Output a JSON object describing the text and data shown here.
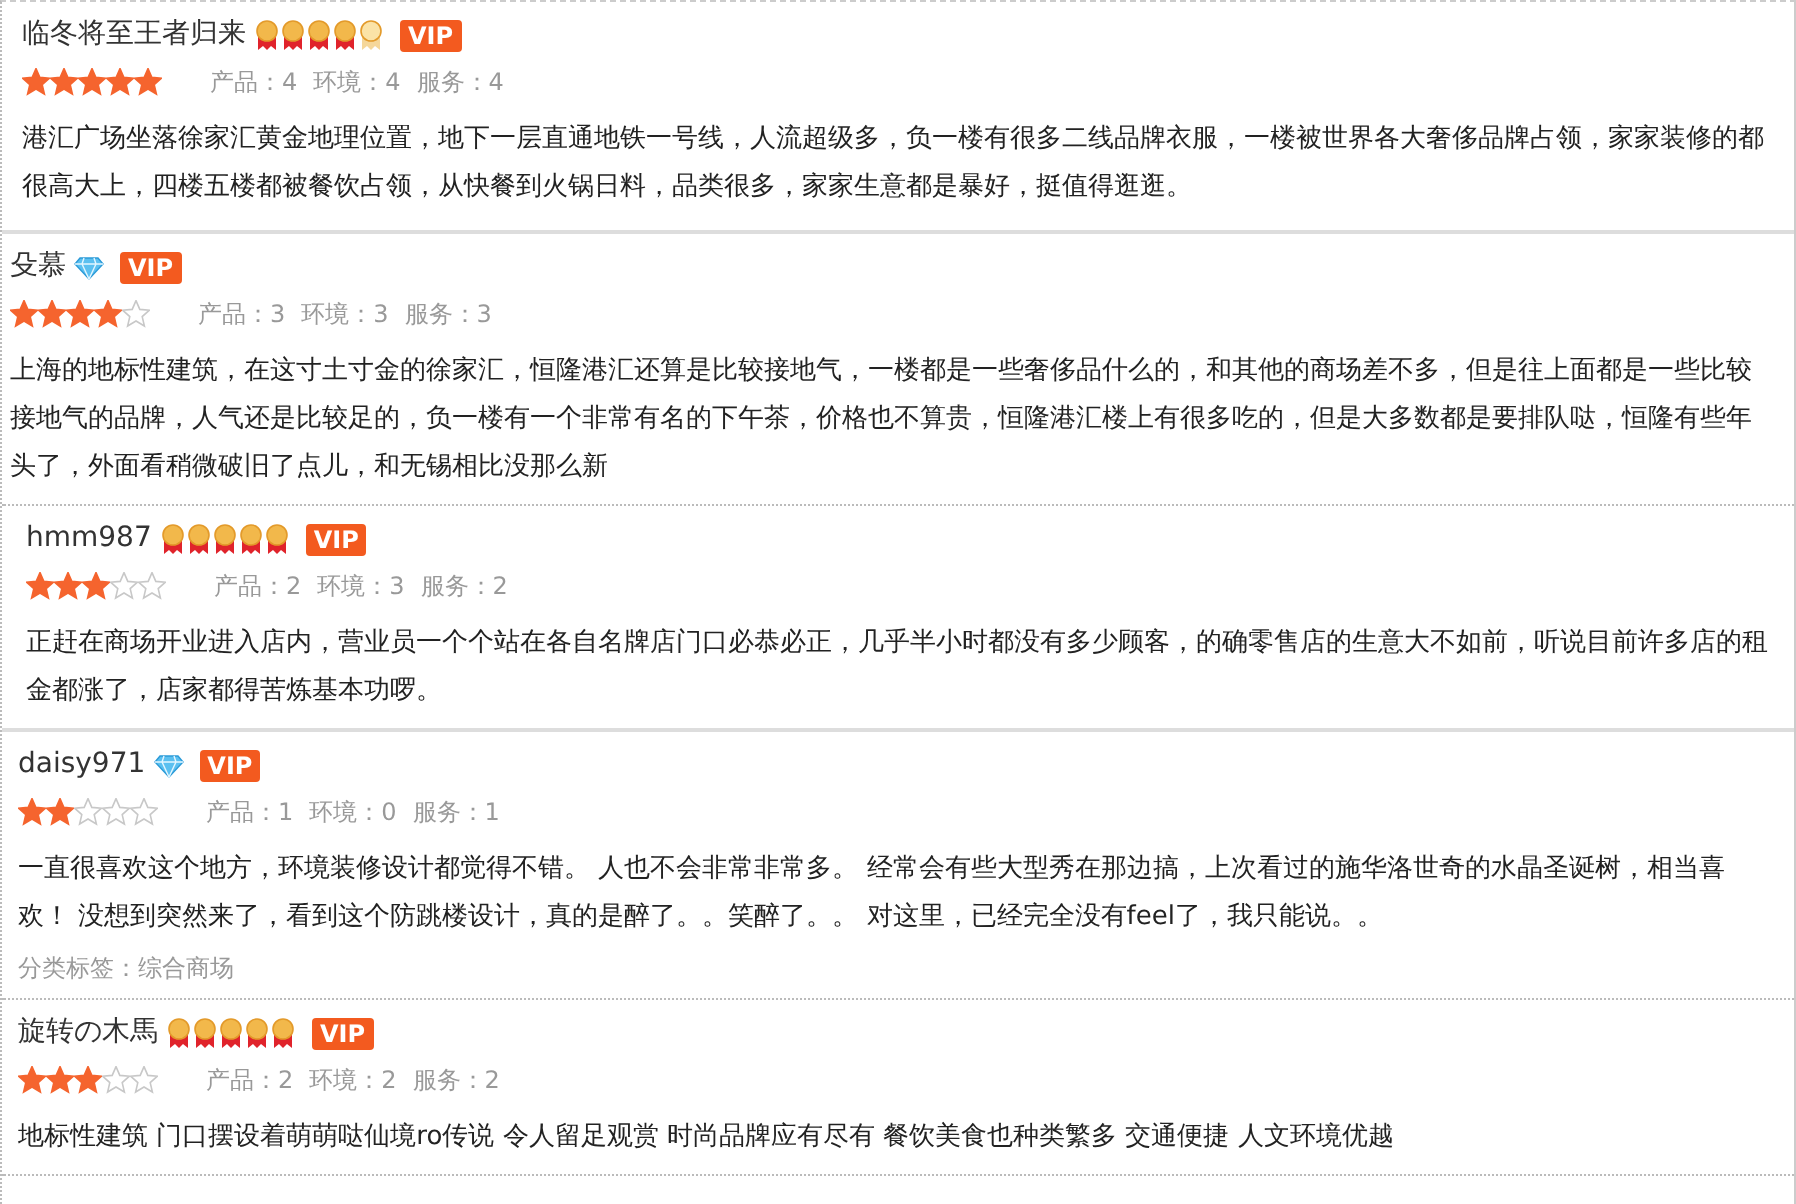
{
  "reviews": [
    {
      "user": "临冬将至王者归来",
      "rank": {
        "kind": "medals",
        "stars": 4
      },
      "vip": "VIP",
      "stars": 5,
      "scores": [
        "产品：4",
        "环境：4",
        "服务：4"
      ],
      "text": "港汇广场坐落徐家汇黄金地理位置，地下一层直通地铁一号线，人流超级多，负一楼有很多二线品牌衣服，一楼被世界各大奢侈品牌占领，家家装修的都很高大上，四楼五楼都被餐饮占领，从快餐到火锅日料，品类很多，家家生意都是暴好，挺值得逛逛。"
    },
    {
      "user": "殳慕",
      "rank": {
        "kind": "diamond"
      },
      "vip": "VIP",
      "stars": 4,
      "scores": [
        "产品：3",
        "环境：3",
        "服务：3"
      ],
      "text": "上海的地标性建筑，在这寸土寸金的徐家汇，恒隆港汇还算是比较接地气，一楼都是一些奢侈品什么的，和其他的商场差不多，但是往上面都是一些比较接地气的品牌，人气还是比较足的，负一楼有一个非常有名的下午茶，价格也不算贵，恒隆港汇楼上有很多吃的，但是大多数都是要排队哒，恒隆有些年头了，外面看稍微破旧了点儿，和无锡相比没那么新"
    },
    {
      "user": "hmm987",
      "rank": {
        "kind": "medals",
        "stars": 5
      },
      "vip": "VIP",
      "stars": 3,
      "scores": [
        "产品：2",
        "环境：3",
        "服务：2"
      ],
      "text": "正赶在商场开业进入店内，营业员一个个站在各自名牌店门口必恭必正，几乎半小时都没有多少顾客，的确零售店的生意大不如前，听说目前许多店的租金都涨了，店家都得苦炼基本功啰。"
    },
    {
      "user": "daisy971",
      "rank": {
        "kind": "diamond"
      },
      "vip": "VIP",
      "stars": 2,
      "scores": [
        "产品：1",
        "环境：0",
        "服务：1"
      ],
      "text": "一直很喜欢这个地方，环境装修设计都觉得不错。 人也不会非常非常多。 经常会有些大型秀在那边搞，上次看过的施华洛世奇的水晶圣诞树，相当喜欢！ 没想到突然来了，看到这个防跳楼设计，真的是醉了。。笑醉了。。 对这里，已经完全没有feel了，我只能说。。",
      "tag": "分类标签：综合商场"
    },
    {
      "user": "旋转の木馬",
      "rank": {
        "kind": "medals",
        "stars": 5
      },
      "vip": "VIP",
      "stars": 3,
      "scores": [
        "产品：2",
        "环境：2",
        "服务：2"
      ],
      "text": "地标性建筑 门口摆设着萌萌哒仙境ro传说 令人留足观赏 时尚品牌应有尽有 餐饮美食也种类繁多 交通便捷 人文环境优越"
    }
  ]
}
